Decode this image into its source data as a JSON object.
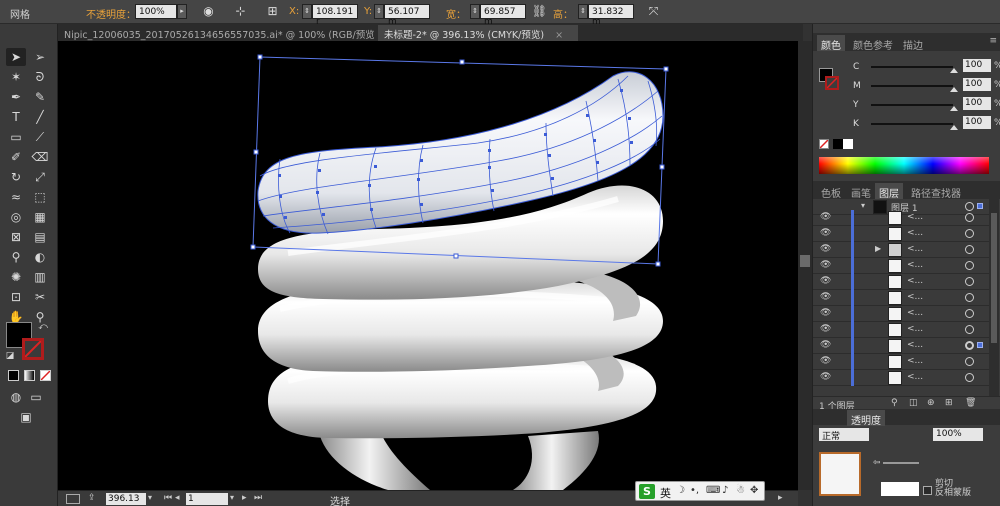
{
  "control_bar": {
    "selection_type": "网格",
    "opacity_label": "不透明度：",
    "opacity_value": "100%",
    "x_label": "X:",
    "x_value": "108.191 r",
    "y_label": "Y:",
    "y_value": "56.107 m",
    "width_label": "宽：",
    "width_value": "69.857 m",
    "height_label": "高：",
    "height_value": "31.832 m"
  },
  "tabs": [
    {
      "label": "Nipic_12006035_20170526134656557035.ai* @ 100% (RGB/预览)",
      "active": false
    },
    {
      "label": "未标题-2* @ 396.13% (CMYK/预览)",
      "active": true
    }
  ],
  "close_glyph": "×",
  "color_panel": {
    "tabs": [
      "颜色",
      "颜色参考",
      "描边"
    ],
    "sliders": [
      {
        "name": "C",
        "value": "100"
      },
      {
        "name": "M",
        "value": "100"
      },
      {
        "name": "Y",
        "value": "100"
      },
      {
        "name": "K",
        "value": "100"
      }
    ],
    "percent": "%"
  },
  "layers_panel": {
    "tabs": [
      "色板",
      "画笔",
      "图层",
      "路径查找器"
    ],
    "top_layer_name": "图层 1",
    "item_label": "<...",
    "footer": "1 个图层"
  },
  "transparency_panel": {
    "tab": "透明度",
    "blend": "正常",
    "opacity": "100%",
    "clip_label": "剪切",
    "invert_label": "反相蒙版"
  },
  "status_bar": {
    "zoom": "396.13",
    "page": "1",
    "mode": "选择"
  },
  "ime": {
    "logo": "S",
    "lang": "英"
  },
  "colors": {
    "accent_blue": "#4b6ed8",
    "mesh_line": "#3b5bd6",
    "tool_orange": "#e8a13a"
  }
}
